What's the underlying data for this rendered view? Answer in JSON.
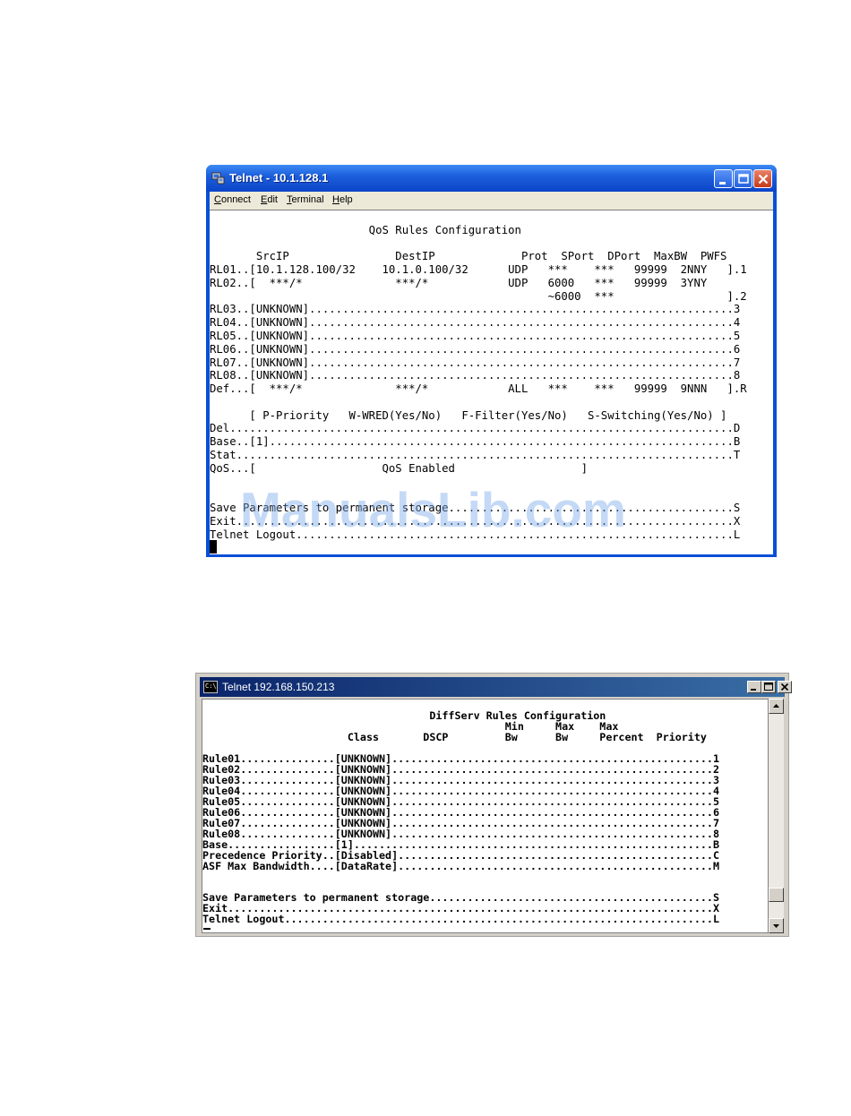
{
  "window1": {
    "title": "Telnet - 10.1.128.1",
    "menu": [
      "Connect",
      "Edit",
      "Terminal",
      "Help"
    ],
    "lines": [
      "                        QoS Rules Configuration",
      "",
      "       SrcIP                DestIP             Prot  SPort  DPort  MaxBW  PWFS",
      "RL01..[10.1.128.100/32    10.1.0.100/32      UDP   ***    ***   99999  2NNY   ].1",
      "RL02..[  ***/*              ***/*            UDP   6000   ***   99999  3YNY",
      "                                                   ~6000  ***                 ].2",
      "RL03..[UNKNOWN]................................................................3",
      "RL04..[UNKNOWN]................................................................4",
      "RL05..[UNKNOWN]................................................................5",
      "RL06..[UNKNOWN]................................................................6",
      "RL07..[UNKNOWN]................................................................7",
      "RL08..[UNKNOWN]................................................................8",
      "Def...[  ***/*              ***/*            ALL   ***    ***   99999  9NNN   ].R",
      "",
      "      [ P-Priority   W-WRED(Yes/No)   F-Filter(Yes/No)   S-Switching(Yes/No) ]",
      "Del............................................................................D",
      "Base..[1]......................................................................B",
      "Stat...........................................................................T",
      "QoS...[                   QoS Enabled                   ]",
      "",
      "",
      "Save Parameters to permanent storage...........................................S",
      "Exit...........................................................................X",
      "Telnet Logout..................................................................L"
    ]
  },
  "window2": {
    "title": "Telnet 192.168.150.213",
    "lines": [
      "",
      "                                    DiffServ Rules Configuration",
      "                                                Min     Max    Max",
      "                       Class       DSCP         Bw      Bw     Percent  Priority",
      "",
      "Rule01...............[UNKNOWN]...................................................1",
      "Rule02...............[UNKNOWN]...................................................2",
      "Rule03...............[UNKNOWN]...................................................3",
      "Rule04...............[UNKNOWN]...................................................4",
      "Rule05...............[UNKNOWN]...................................................5",
      "Rule06...............[UNKNOWN]...................................................6",
      "Rule07...............[UNKNOWN]...................................................7",
      "Rule08...............[UNKNOWN]...................................................8",
      "Base.................[1].........................................................B",
      "Precedence Priority..[Disabled]..................................................C",
      "ASF Max Bandwidth....[DataRate]..................................................M",
      "",
      "",
      "Save Parameters to permanent storage.............................................S",
      "Exit.............................................................................X",
      "Telnet Logout....................................................................L"
    ]
  },
  "watermark": "ManualsLib.com",
  "colors": {
    "xp_title": "#1d5fdc",
    "classic_title": "#0a246a",
    "watermark": "#7daaeb"
  }
}
